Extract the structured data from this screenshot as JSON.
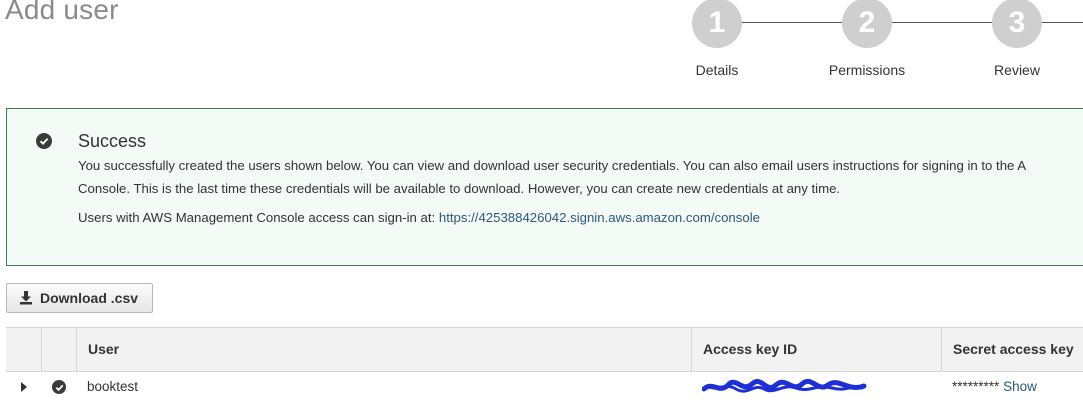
{
  "page": {
    "title": "Add user"
  },
  "stepper": {
    "steps": [
      {
        "number": "1",
        "label": "Details"
      },
      {
        "number": "2",
        "label": "Permissions"
      },
      {
        "number": "3",
        "label": "Review"
      }
    ]
  },
  "success": {
    "title": "Success",
    "line1": "You successfully created the users shown below. You can view and download user security credentials. You can also email users instructions for signing in to the A",
    "line2": "Console. This is the last time these credentials will be available to download. However, you can create new credentials at any time.",
    "signin_prefix": "Users with AWS Management Console access can sign-in at: ",
    "signin_url": "https://425388426042.signin.aws.amazon.com/console"
  },
  "download_button": {
    "label": "Download .csv",
    "icon": "download-icon"
  },
  "table": {
    "columns": [
      "User",
      "Access key ID",
      "Secret access key"
    ],
    "rows": [
      {
        "user": "booktest",
        "access_key_masked": "",
        "secret_mask": "*********",
        "show_label": "Show"
      }
    ]
  },
  "colors": {
    "success_border": "#3c7d54",
    "success_bg": "#f4faf6",
    "link": "#2b5a7a",
    "step_circle": "#cfcfcf",
    "scribble": "#1f2fd6"
  }
}
